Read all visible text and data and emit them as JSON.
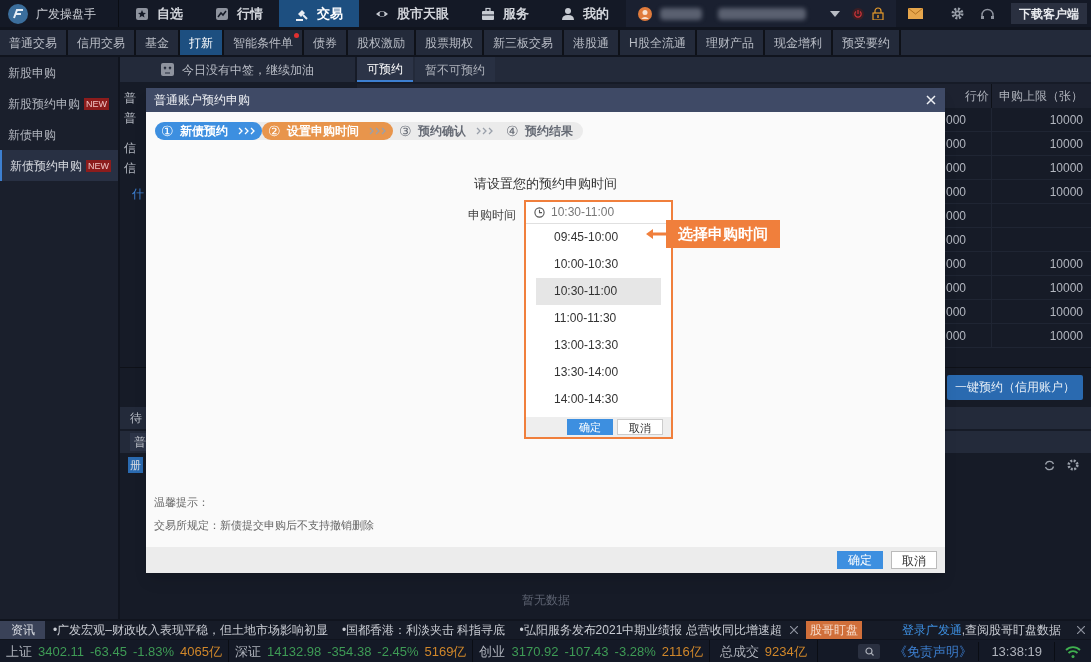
{
  "app": {
    "name": "广发操盘手"
  },
  "main_tabs": [
    {
      "label": "自选",
      "selected": false
    },
    {
      "label": "行情",
      "selected": false
    },
    {
      "label": "交易",
      "selected": true
    },
    {
      "label": "股市天眼",
      "selected": false
    },
    {
      "label": "服务",
      "selected": false
    },
    {
      "label": "我的",
      "selected": false
    }
  ],
  "download_button": "下载客户端",
  "sub_tabs": [
    {
      "label": "普通交易",
      "selected": false,
      "badge": false
    },
    {
      "label": "信用交易",
      "selected": false,
      "badge": false
    },
    {
      "label": "基金",
      "selected": false,
      "badge": false
    },
    {
      "label": "打新",
      "selected": true,
      "badge": false
    },
    {
      "label": "智能条件单",
      "selected": false,
      "badge": true
    },
    {
      "label": "债券",
      "selected": false,
      "badge": false
    },
    {
      "label": "股权激励",
      "selected": false,
      "badge": false
    },
    {
      "label": "股票期权",
      "selected": false,
      "badge": false
    },
    {
      "label": "新三板交易",
      "selected": false,
      "badge": false
    },
    {
      "label": "港股通",
      "selected": false,
      "badge": false
    },
    {
      "label": "H股全流通",
      "selected": false,
      "badge": false
    },
    {
      "label": "理财产品",
      "selected": false,
      "badge": false
    },
    {
      "label": "现金增利",
      "selected": false,
      "badge": false
    },
    {
      "label": "预受要约",
      "selected": false,
      "badge": false
    }
  ],
  "sidebar": {
    "items": [
      {
        "label": "新股申购",
        "selected": false
      },
      {
        "label": "新股预约申购",
        "badge": "NEW",
        "selected": false
      },
      {
        "label": "新债申购",
        "selected": false
      },
      {
        "label": "新债预约申购",
        "badge": "NEW",
        "selected": true
      }
    ]
  },
  "notice": "今日没有中签，继续加油",
  "panel_fragments": [
    {
      "text": "普",
      "kind": "text"
    },
    {
      "text": "普",
      "kind": "text"
    },
    {
      "text": "信",
      "kind": "text"
    },
    {
      "text": "信",
      "kind": "text"
    },
    {
      "text": "什",
      "kind": "link"
    }
  ],
  "list_tabs": [
    {
      "label": "可预约",
      "selected": true
    },
    {
      "label": "暂不可预约",
      "selected": false
    }
  ],
  "table": {
    "columns": [
      "行价",
      "申购上限（张）"
    ],
    "rows": [
      [
        "000",
        "10000"
      ],
      [
        "000",
        "10000"
      ],
      [
        "000",
        "10000"
      ],
      [
        "000",
        "10000"
      ],
      [
        "000",
        ""
      ],
      [
        "000",
        ""
      ],
      [
        "000",
        "10000"
      ],
      [
        "000",
        "10000"
      ],
      [
        "000",
        "10000"
      ],
      [
        "000",
        "10000"
      ]
    ]
  },
  "reserve_credit_button": "一键预约（信用账户）",
  "lower_fragments": [
    "待",
    "普",
    "册"
  ],
  "empty_text": "暂无数据",
  "dialog": {
    "title": "普通账户预约申购",
    "steps": [
      {
        "number": "①",
        "label": "新债预约",
        "kind": "done"
      },
      {
        "number": "②",
        "label": "设置申购时间",
        "kind": "current"
      },
      {
        "number": "③",
        "label": "预约确认",
        "kind": "pending"
      },
      {
        "number": "④",
        "label": "预约结果",
        "kind": "pending"
      }
    ],
    "heading": "请设置您的预约申购时间",
    "field_label": "申购时间",
    "field_value": "10:30-11:00",
    "options": [
      {
        "label": "09:45-10:00",
        "selected": false
      },
      {
        "label": "10:00-10:30",
        "selected": false
      },
      {
        "label": "10:30-11:00",
        "selected": true
      },
      {
        "label": "11:00-11:30",
        "selected": false
      },
      {
        "label": "13:00-13:30",
        "selected": false
      },
      {
        "label": "13:30-14:00",
        "selected": false
      },
      {
        "label": "14:00-14:30",
        "selected": false
      }
    ],
    "dropdown_buttons": [
      "确定",
      "取消"
    ],
    "callout": "选择申购时间",
    "tips_title": "温馨提示：",
    "tips": [
      "交易所规定：新债提交申购后不支持撤销删除"
    ],
    "buttons": [
      "确定",
      "取消"
    ]
  },
  "news": {
    "label": "资讯",
    "items": [
      "•广发宏观–财政收入表现平稳，但土地市场影响初显",
      "•国都香港：利淡夹击 科指寻底",
      "•弘阳服务发布2021中期业绩报 总营收同比增速超"
    ],
    "badge": "股哥盯盘",
    "login_link": "登录广发通",
    "login_text": ",查阅股哥盯盘数据"
  },
  "ticker": [
    {
      "name": "上证",
      "value": "3402.11",
      "change": "-63.45",
      "percent": "-1.83%",
      "volume": "4065亿"
    },
    {
      "name": "深证",
      "value": "14132.98",
      "change": "-354.38",
      "percent": "-2.45%",
      "volume": "5169亿"
    },
    {
      "name": "创业",
      "value": "3170.92",
      "change": "-107.43",
      "percent": "-3.28%",
      "volume": "2116亿"
    }
  ],
  "total": {
    "label": "总成交",
    "volume": "9234亿"
  },
  "disclaimer": "《免责声明》",
  "time": "13:38:19"
}
